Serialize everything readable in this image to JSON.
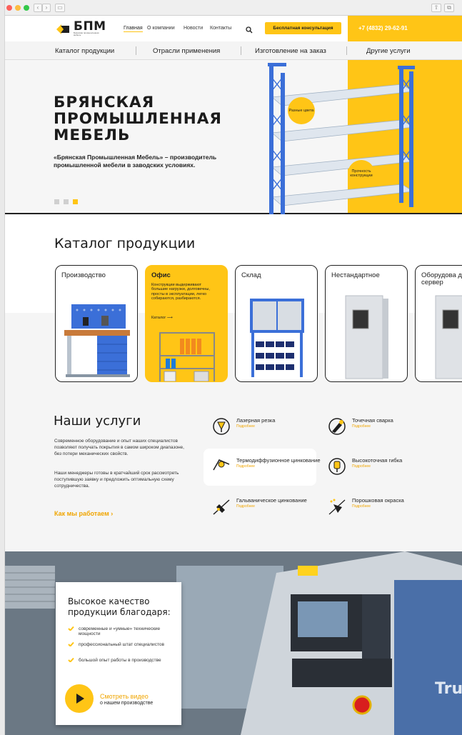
{
  "header": {
    "logo_text": "БПМ",
    "logo_sub": "Брянская промышленная мебель",
    "nav": [
      "Главная",
      "О компании",
      "Новости",
      "Контакты"
    ],
    "cta": "Бесплатная консультация",
    "phone": "+7 (4832) 29-62-91"
  },
  "catnav": [
    "Каталог продукции",
    "Отрасли применения",
    "Изготовление на заказ",
    "Другие услуги"
  ],
  "hero": {
    "title": "БРЯНСКАЯ ПРОМЫШЛЕННАЯ МЕБЕЛЬ",
    "desc": "«Брянская Промышленная Мебель» – производитель промышленной мебели в заводских условиях.",
    "bubble1": "Разные цвета",
    "bubble2": "Прочность конструкции",
    "slides": 3,
    "active_slide": 3
  },
  "catalog": {
    "title": "Каталог продукции",
    "cards": [
      {
        "title": "Производство"
      },
      {
        "title": "Офис",
        "desc": "Конструкции выдерживают большие нагрузки, долговечны, просты в эксплуатации, легко собираются, разбираются.",
        "more": "Каталог ⟶"
      },
      {
        "title": "Склад"
      },
      {
        "title": "Нестандартное"
      },
      {
        "title": "Оборудова для сервер"
      }
    ]
  },
  "services": {
    "title": "Наши услуги",
    "p1": "Современное оборудование и опыт наших специалистов позволяют получать покрытия в самом широком диапазоне, без потери механических свойств.",
    "p2": "Наши менеджеры готовы в кратчайший срок рассмотреть поступившую заявку и предложить оптимальную схему сотрудничества.",
    "how": "Как мы работаем  ›",
    "more": "Подробнее",
    "items": [
      {
        "name": "Лазерная резка"
      },
      {
        "name": "Точечная сварка"
      },
      {
        "name": "Термодиффузионное цинкование"
      },
      {
        "name": "Высокоточная гибка"
      },
      {
        "name": "Гальваническое цинкование"
      },
      {
        "name": "Порошковая окраска"
      }
    ]
  },
  "quality": {
    "title": "Высокое качество продукции благодаря:",
    "items": [
      "современные и «умные» технические мощности",
      "профессиональный штат специалистов",
      "большой опыт работы в производстве"
    ],
    "video1": "Смотреть видео",
    "video2": "о нашем производстве",
    "machine_brand": "TruLas"
  },
  "colors": {
    "accent": "#ffc516",
    "dark": "#1e1e1e",
    "rack_blue": "#3b6fd8"
  }
}
